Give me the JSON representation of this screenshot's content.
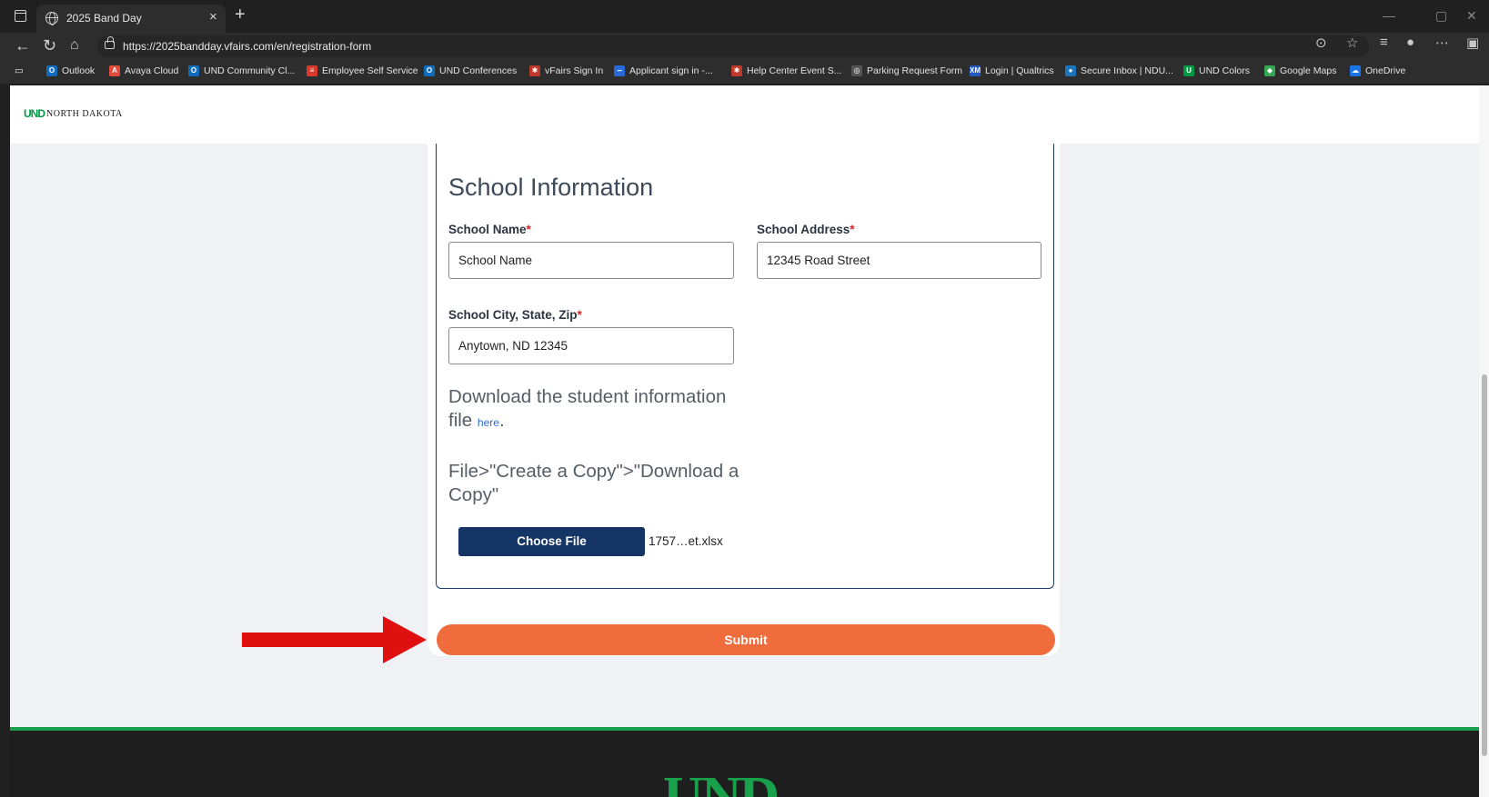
{
  "browser": {
    "tab_title": "2025 Band Day",
    "tab_close": "×",
    "new_tab": "+",
    "url": "https://2025bandday.vfairs.com/en/registration-form",
    "window_controls": {
      "minimize": "—",
      "restore": "▢",
      "close": "✕"
    }
  },
  "bookmarks": [
    {
      "label": "Outlook",
      "icon": "outlook-icon",
      "color": "#0f6cbd",
      "glyph": "O"
    },
    {
      "label": "Avaya Cloud",
      "icon": "avaya-icon",
      "color": "#e24b3b",
      "glyph": "A"
    },
    {
      "label": "UND Community Cl...",
      "icon": "outlook-icon",
      "color": "#0f6cbd",
      "glyph": "O"
    },
    {
      "label": "Employee Self Service",
      "icon": "ess-icon",
      "color": "#d83b2b",
      "glyph": "≡"
    },
    {
      "label": "UND Conferences",
      "icon": "outlook-icon",
      "color": "#0f6cbd",
      "glyph": "O"
    },
    {
      "label": "vFairs Sign In",
      "icon": "vfairs-icon",
      "color": "#c0392b",
      "glyph": "✱"
    },
    {
      "label": "Applicant sign in -...",
      "icon": "applicant-icon",
      "color": "#2a6ad6",
      "glyph": "∽"
    },
    {
      "label": "Help Center Event S...",
      "icon": "vfairs-icon",
      "color": "#c0392b",
      "glyph": "✱"
    },
    {
      "label": "Parking Request Form",
      "icon": "globe-icon",
      "color": "#555555",
      "glyph": "◎"
    },
    {
      "label": "Login | Qualtrics",
      "icon": "qualtrics-icon",
      "color": "#2158c4",
      "glyph": "XM"
    },
    {
      "label": "Secure Inbox | NDU...",
      "icon": "secure-inbox-icon",
      "color": "#1b75bc",
      "glyph": "●"
    },
    {
      "label": "UND Colors",
      "icon": "und-colors-icon",
      "color": "#009a44",
      "glyph": "U"
    },
    {
      "label": "Google Maps",
      "icon": "maps-icon",
      "color": "#34a853",
      "glyph": "◆"
    },
    {
      "label": "OneDrive",
      "icon": "onedrive-icon",
      "color": "#1a73e8",
      "glyph": "☁"
    }
  ],
  "header": {
    "logo_und": "UND",
    "logo_name": "NORTH DAKOTA"
  },
  "form": {
    "section_title": "School Information",
    "school_name": {
      "label": "School Name",
      "required": "*",
      "value": "School Name"
    },
    "school_address": {
      "label": "School Address",
      "required": "*",
      "value": "12345 Road Street"
    },
    "school_city": {
      "label": "School City, State, Zip",
      "required": "*",
      "value": "Anytown, ND 12345"
    },
    "download_text": "Download the student information file",
    "download_link": "here",
    "download_period": ".",
    "copy_instructions": "File>\"Create a Copy\">\"Download a Copy\"",
    "choose_file_label": "Choose File",
    "file_name": "1757…et.xlsx",
    "submit_label": "Submit"
  },
  "footer": {
    "logo": "UND"
  },
  "colors": {
    "accent_orange": "#f06c3c",
    "navy": "#153566",
    "und_green": "#009a44",
    "annotation_arrow": "#e01010"
  }
}
